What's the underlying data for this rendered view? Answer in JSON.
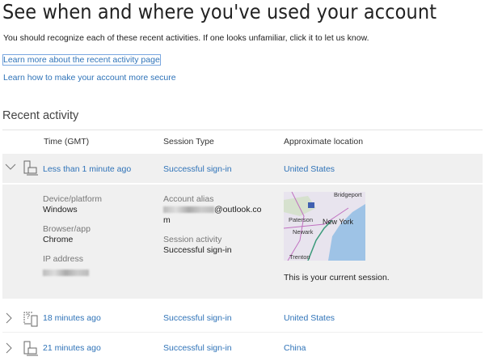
{
  "title": "See when and where you've used your account",
  "subtitle": "You should recognize each of these recent activities. If one looks unfamiliar, click it to let us know.",
  "links": [
    "Learn more about the recent activity page",
    "Learn how to make your account more secure"
  ],
  "section_title": "Recent activity",
  "columns": [
    "Time (GMT)",
    "Session Type",
    "Approximate location"
  ],
  "rows": [
    {
      "time": "Less than 1 minute ago",
      "session": "Successful sign-in",
      "location": "United States",
      "icon": "desktop-laptop-icon",
      "expanded": true
    },
    {
      "time": "18 minutes ago",
      "session": "Successful sign-in",
      "location": "United States",
      "icon": "unknown-device-icon",
      "expanded": false
    },
    {
      "time": "21 minutes ago",
      "session": "Successful sign-in",
      "location": "China",
      "icon": "desktop-laptop-icon",
      "expanded": false
    }
  ],
  "details": {
    "device_label": "Device/platform",
    "device": "Windows",
    "browser_label": "Browser/app",
    "browser": "Chrome",
    "ip_label": "IP address",
    "alias_label": "Account alias",
    "alias_domain": "@outlook.co",
    "alias_wrap": "m",
    "activity_label": "Session activity",
    "activity": "Successful sign-in",
    "map_labels": [
      "Bridgeport",
      "Paterson",
      "New York",
      "Newark",
      "Trenton"
    ],
    "current_session": "This is your current session."
  }
}
